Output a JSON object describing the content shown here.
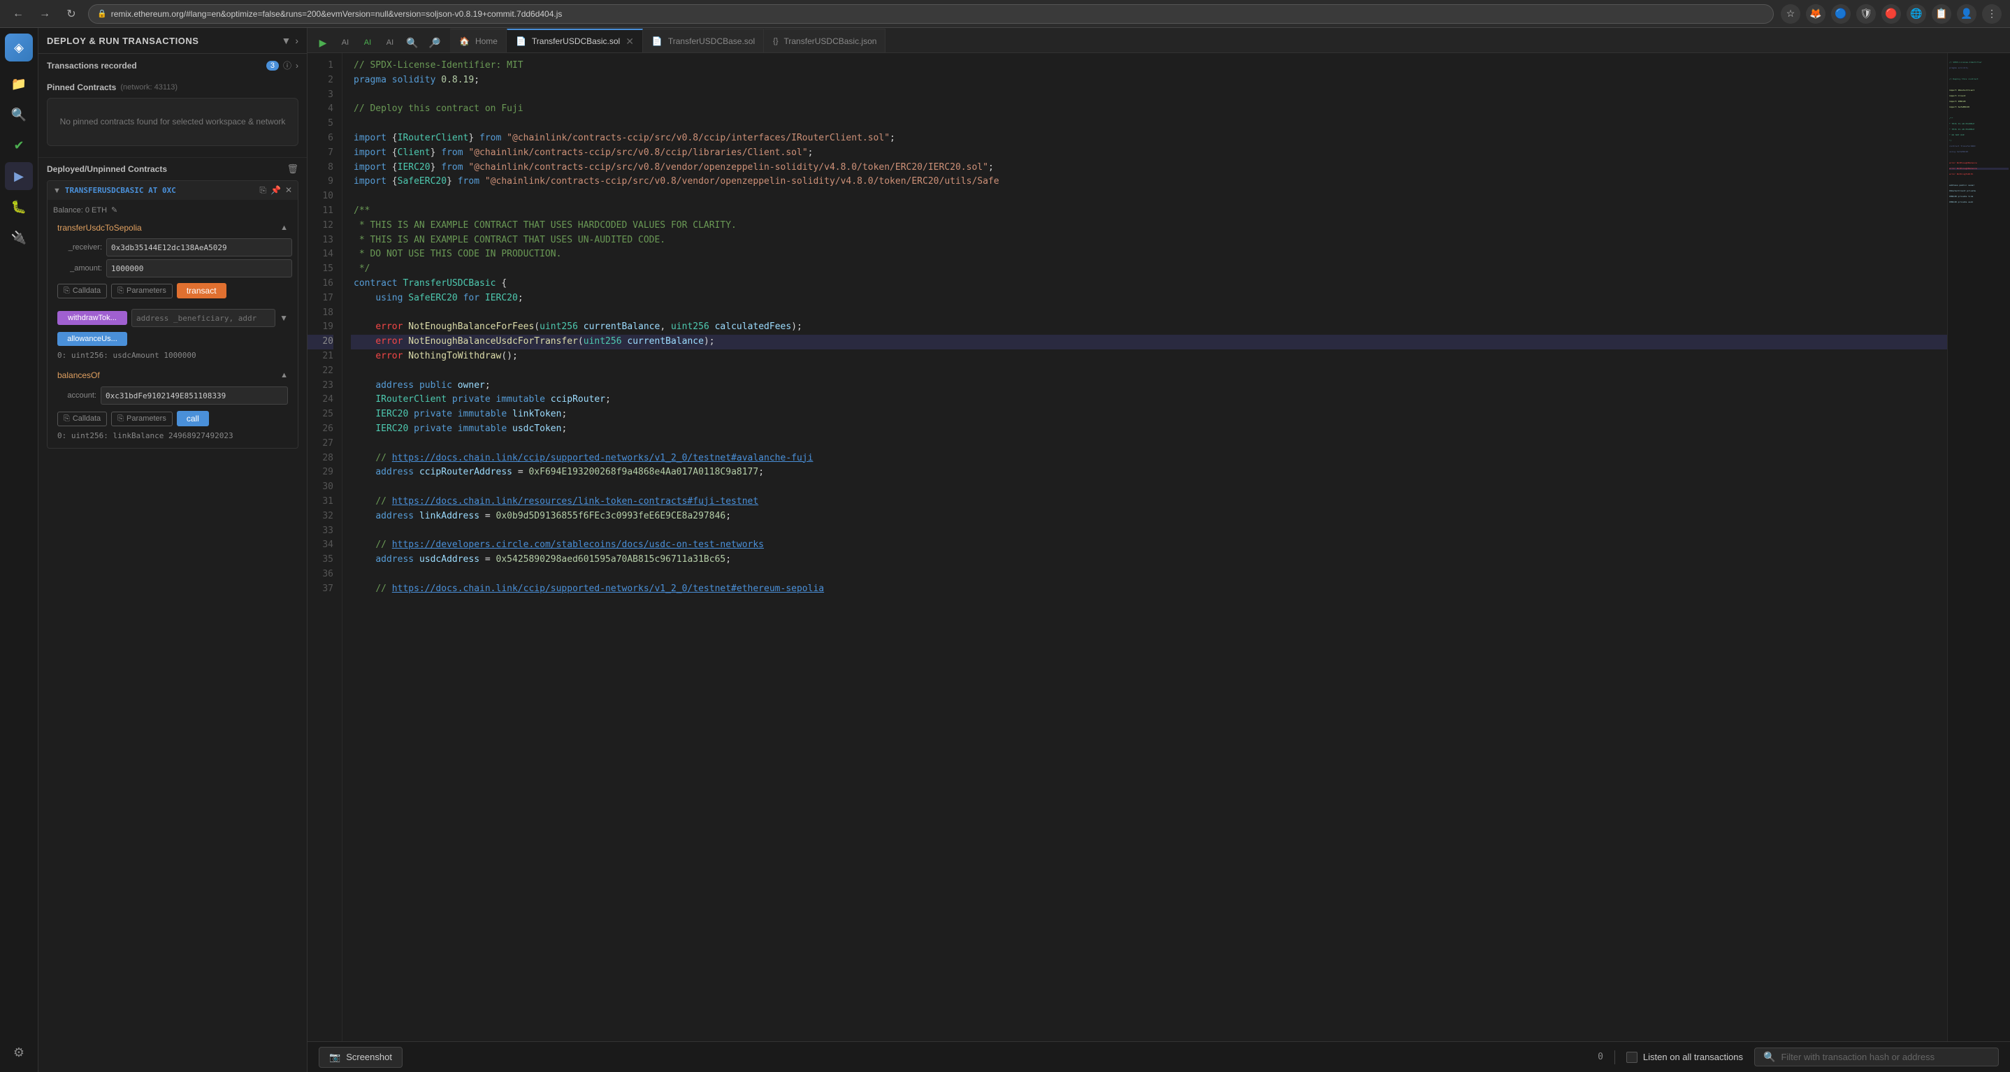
{
  "browser": {
    "url": "remix.ethereum.org/#lang=en&optimize=false&runs=200&evmVersion=null&version=soljson-v0.8.19+commit.7dd6d404.js",
    "back_label": "←",
    "forward_label": "→",
    "refresh_label": "↻",
    "home_label": "⌂"
  },
  "sidebar": {
    "logo": "◈",
    "items": [
      {
        "icon": "📁",
        "label": "file-explorer-icon",
        "active": false
      },
      {
        "icon": "🔍",
        "label": "search-icon",
        "active": false
      },
      {
        "icon": "✔",
        "label": "solidity-compiler-icon",
        "active": false
      },
      {
        "icon": "▶",
        "label": "deploy-run-icon",
        "active": true
      },
      {
        "icon": "🐛",
        "label": "debug-icon",
        "active": false
      },
      {
        "icon": "🔌",
        "label": "plugin-manager-icon",
        "active": false
      }
    ],
    "bottom_items": [
      {
        "icon": "⚙",
        "label": "settings-icon"
      }
    ]
  },
  "deploy_panel": {
    "title": "DEPLOY & RUN TRANSACTIONS",
    "transactions_recorded": {
      "label": "Transactions recorded",
      "count": "3"
    },
    "pinned_contracts": {
      "label": "Pinned Contracts",
      "network": "(network: 43113)",
      "empty_message": "No pinned contracts found for selected workspace & network"
    },
    "deployed_section": {
      "label": "Deployed/Unpinned Contracts"
    },
    "contract": {
      "name": "TRANSFERUSDCBASIC AT 0XC",
      "balance": "Balance: 0 ETH",
      "functions": [
        {
          "name": "transferUsdcToSepolia",
          "params": [
            {
              "label": "_receiver:",
              "value": "0x3db35144E12dc138AeA5029"
            },
            {
              "label": "_amount:",
              "value": "1000000"
            }
          ],
          "actions": [
            "Calldata",
            "Parameters",
            "transact"
          ]
        },
        {
          "name": "withdrawTok...",
          "param_placeholder": "address _beneficiary, addr",
          "has_chevron": true
        },
        {
          "name": "allowanceUs...",
          "output": "0: uint256: usdcAmount 1000000"
        }
      ],
      "balances": {
        "name": "balancesOf",
        "account_label": "account:",
        "account_value": "0xc31bdFe9102149E851108339",
        "actions": [
          "Calldata",
          "Parameters",
          "call"
        ],
        "output": "0: uint256: linkBalance 24968927492023"
      }
    }
  },
  "editor": {
    "toolbar_buttons": [
      "▶",
      "AI",
      "AI",
      "AI",
      "🔍",
      "🔍"
    ],
    "tabs": [
      {
        "label": "Home",
        "icon": "🏠",
        "closeable": false
      },
      {
        "label": "TransferUSDCBasic.sol",
        "icon": "📄",
        "closeable": true,
        "active": true
      },
      {
        "label": "TransferUSDCBase.sol",
        "icon": "📄",
        "closeable": false
      },
      {
        "label": "TransferUSDCBasic.json",
        "icon": "{}",
        "closeable": false
      }
    ],
    "lines": [
      {
        "num": 1,
        "content": "// SPDX-License-Identifier: MIT",
        "type": "comment"
      },
      {
        "num": 2,
        "content": "pragma solidity 0.8.19;",
        "type": "pragma"
      },
      {
        "num": 3,
        "content": "",
        "type": "blank"
      },
      {
        "num": 4,
        "content": "// Deploy this contract on Fuji",
        "type": "comment"
      },
      {
        "num": 5,
        "content": "",
        "type": "blank"
      },
      {
        "num": 6,
        "content": "import {IRouterClient} from \"@chainlink/contracts-ccip/src/v0.8/ccip/interfaces/IRouterClient.sol\";",
        "type": "import"
      },
      {
        "num": 7,
        "content": "import {Client} from \"@chainlink/contracts-ccip/src/v0.8/ccip/libraries/Client.sol\";",
        "type": "import"
      },
      {
        "num": 8,
        "content": "import {IERC20} from \"@chainlink/contracts-ccip/src/v0.8/vendor/openzeppelin-solidity/v4.8.0/token/ERC20/IERC20.sol\";",
        "type": "import"
      },
      {
        "num": 9,
        "content": "import {SafeERC20} from \"@chainlink/contracts-ccip/src/v0.8/vendor/openzeppelin-solidity/v4.8.0/token/ERC20/utils/Safe",
        "type": "import"
      },
      {
        "num": 10,
        "content": "",
        "type": "blank"
      },
      {
        "num": 11,
        "content": "/**",
        "type": "comment"
      },
      {
        "num": 12,
        "content": " * THIS IS AN EXAMPLE CONTRACT THAT USES HARDCODED VALUES FOR CLARITY.",
        "type": "comment"
      },
      {
        "num": 13,
        "content": " * THIS IS AN EXAMPLE CONTRACT THAT USES UN-AUDITED CODE.",
        "type": "comment"
      },
      {
        "num": 14,
        "content": " * DO NOT USE THIS CODE IN PRODUCTION.",
        "type": "comment"
      },
      {
        "num": 15,
        "content": " */",
        "type": "comment"
      },
      {
        "num": 16,
        "content": "contract TransferUSDCBasic {",
        "type": "contract"
      },
      {
        "num": 17,
        "content": "    using SafeERC20 for IERC20;",
        "type": "using"
      },
      {
        "num": 18,
        "content": "",
        "type": "blank"
      },
      {
        "num": 19,
        "content": "    error NotEnoughBalanceForFees(uint256 currentBalance, uint256 calculatedFees);",
        "type": "error"
      },
      {
        "num": 20,
        "content": "    error NotEnoughBalanceUsdcForTransfer(uint256 currentBalance);",
        "type": "error",
        "highlighted": true
      },
      {
        "num": 21,
        "content": "    error NothingToWithdraw();",
        "type": "error"
      },
      {
        "num": 22,
        "content": "",
        "type": "blank"
      },
      {
        "num": 23,
        "content": "    address public owner;",
        "type": "decl"
      },
      {
        "num": 24,
        "content": "    IRouterClient private immutable ccipRouter;",
        "type": "decl"
      },
      {
        "num": 25,
        "content": "    IERC20 private immutable linkToken;",
        "type": "decl"
      },
      {
        "num": 26,
        "content": "    IERC20 private immutable usdcToken;",
        "type": "decl"
      },
      {
        "num": 27,
        "content": "",
        "type": "blank"
      },
      {
        "num": 28,
        "content": "    // https://docs.chain.link/ccip/supported-networks/v1_2_0/testnet#avalanche-fuji",
        "type": "comment-link"
      },
      {
        "num": 29,
        "content": "    address ccipRouterAddress = 0xF694E193200268f9a4868e4Aa017A0118C9a8177;",
        "type": "decl"
      },
      {
        "num": 30,
        "content": "",
        "type": "blank"
      },
      {
        "num": 31,
        "content": "    // https://docs.chain.link/resources/link-token-contracts#fuji-testnet",
        "type": "comment-link"
      },
      {
        "num": 32,
        "content": "    address linkAddress = 0x0b9d5D9136855f6FEc3c0993feE6E9CE8a297846;",
        "type": "decl"
      },
      {
        "num": 33,
        "content": "",
        "type": "blank"
      },
      {
        "num": 34,
        "content": "    // https://developers.circle.com/stablecoins/docs/usdc-on-test-networks",
        "type": "comment-link"
      },
      {
        "num": 35,
        "content": "    address usdcAddress = 0x5425890298aed601595a70AB815c96711a31Bc65;",
        "type": "decl"
      },
      {
        "num": 36,
        "content": "",
        "type": "blank"
      },
      {
        "num": 37,
        "content": "    // https://docs.chain.link/ccip/supported-networks/v1_2_0/testnet#ethereum-sepolia",
        "type": "comment-link"
      }
    ]
  },
  "status_bar": {
    "screenshot_label": "Screenshot",
    "line_count": "0",
    "listen_label": "Listen on all transactions",
    "filter_placeholder": "Filter with transaction hash or address"
  }
}
